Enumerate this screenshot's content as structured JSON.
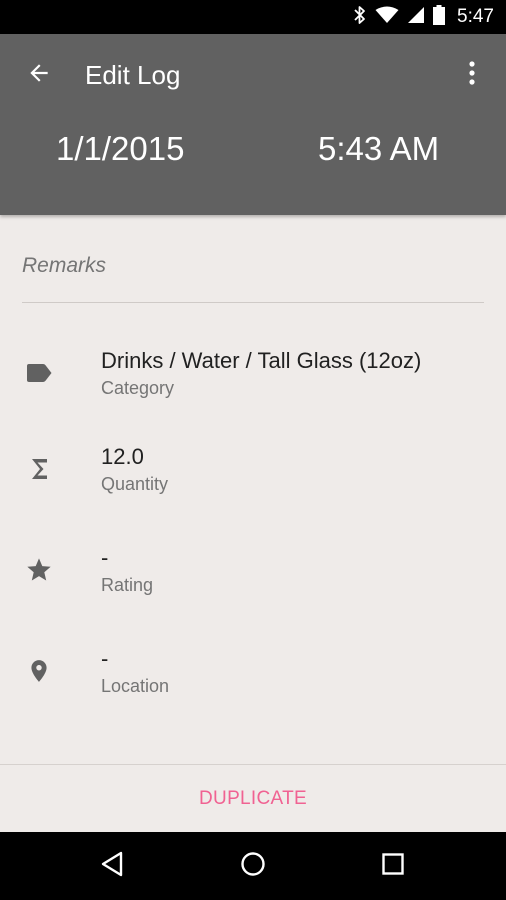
{
  "status_bar": {
    "time": "5:47",
    "icons": [
      "bluetooth-icon",
      "wifi-icon",
      "signal-icon",
      "battery-icon"
    ]
  },
  "app_bar": {
    "title": "Edit Log",
    "date": "1/1/2015",
    "time": "5:43 AM",
    "color": "#616161"
  },
  "remarks": {
    "placeholder": "Remarks",
    "value": ""
  },
  "fields": [
    {
      "icon": "tag-icon",
      "value": "Drinks / Water / Tall Glass (12oz)",
      "label": "Category"
    },
    {
      "icon": "sigma-icon",
      "value": "12.0",
      "label": "Quantity"
    },
    {
      "icon": "star-icon",
      "value": "-",
      "label": "Rating"
    },
    {
      "icon": "location-pin-icon",
      "value": "-",
      "label": "Location"
    }
  ],
  "footer": {
    "duplicate_label": "DUPLICATE",
    "accent_color": "#f06292"
  },
  "nav_bar": {
    "buttons": [
      "back-nav-icon",
      "home-nav-icon",
      "recents-nav-icon"
    ]
  }
}
